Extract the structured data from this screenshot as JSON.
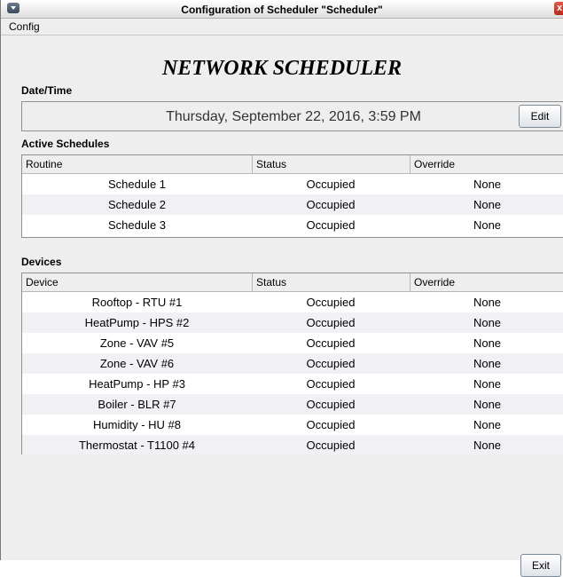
{
  "window": {
    "title": "Configuration of Scheduler \"Scheduler\"",
    "close_label": "x"
  },
  "menubar": {
    "config": "Config"
  },
  "heading": "NETWORK SCHEDULER",
  "datetime": {
    "label": "Date/Time",
    "value": "Thursday, September 22, 2016, 3:59 PM",
    "edit_label": "Edit"
  },
  "active_schedules": {
    "label": "Active Schedules",
    "columns": [
      "Routine",
      "Status",
      "Override"
    ],
    "rows": [
      [
        "Schedule 1",
        "Occupied",
        "None"
      ],
      [
        "Schedule 2",
        "Occupied",
        "None"
      ],
      [
        "Schedule 3",
        "Occupied",
        "None"
      ]
    ]
  },
  "devices": {
    "label": "Devices",
    "columns": [
      "Device",
      "Status",
      "Override"
    ],
    "rows": [
      [
        "Rooftop - RTU #1",
        "Occupied",
        "None"
      ],
      [
        "HeatPump - HPS #2",
        "Occupied",
        "None"
      ],
      [
        "Zone - VAV #5",
        "Occupied",
        "None"
      ],
      [
        "Zone - VAV #6",
        "Occupied",
        "None"
      ],
      [
        "HeatPump - HP #3",
        "Occupied",
        "None"
      ],
      [
        "Boiler - BLR #7",
        "Occupied",
        "None"
      ],
      [
        "Humidity - HU #8",
        "Occupied",
        "None"
      ],
      [
        "Thermostat - T1100 #4",
        "Occupied",
        "None"
      ]
    ]
  },
  "footer": {
    "exit_label": "Exit"
  }
}
